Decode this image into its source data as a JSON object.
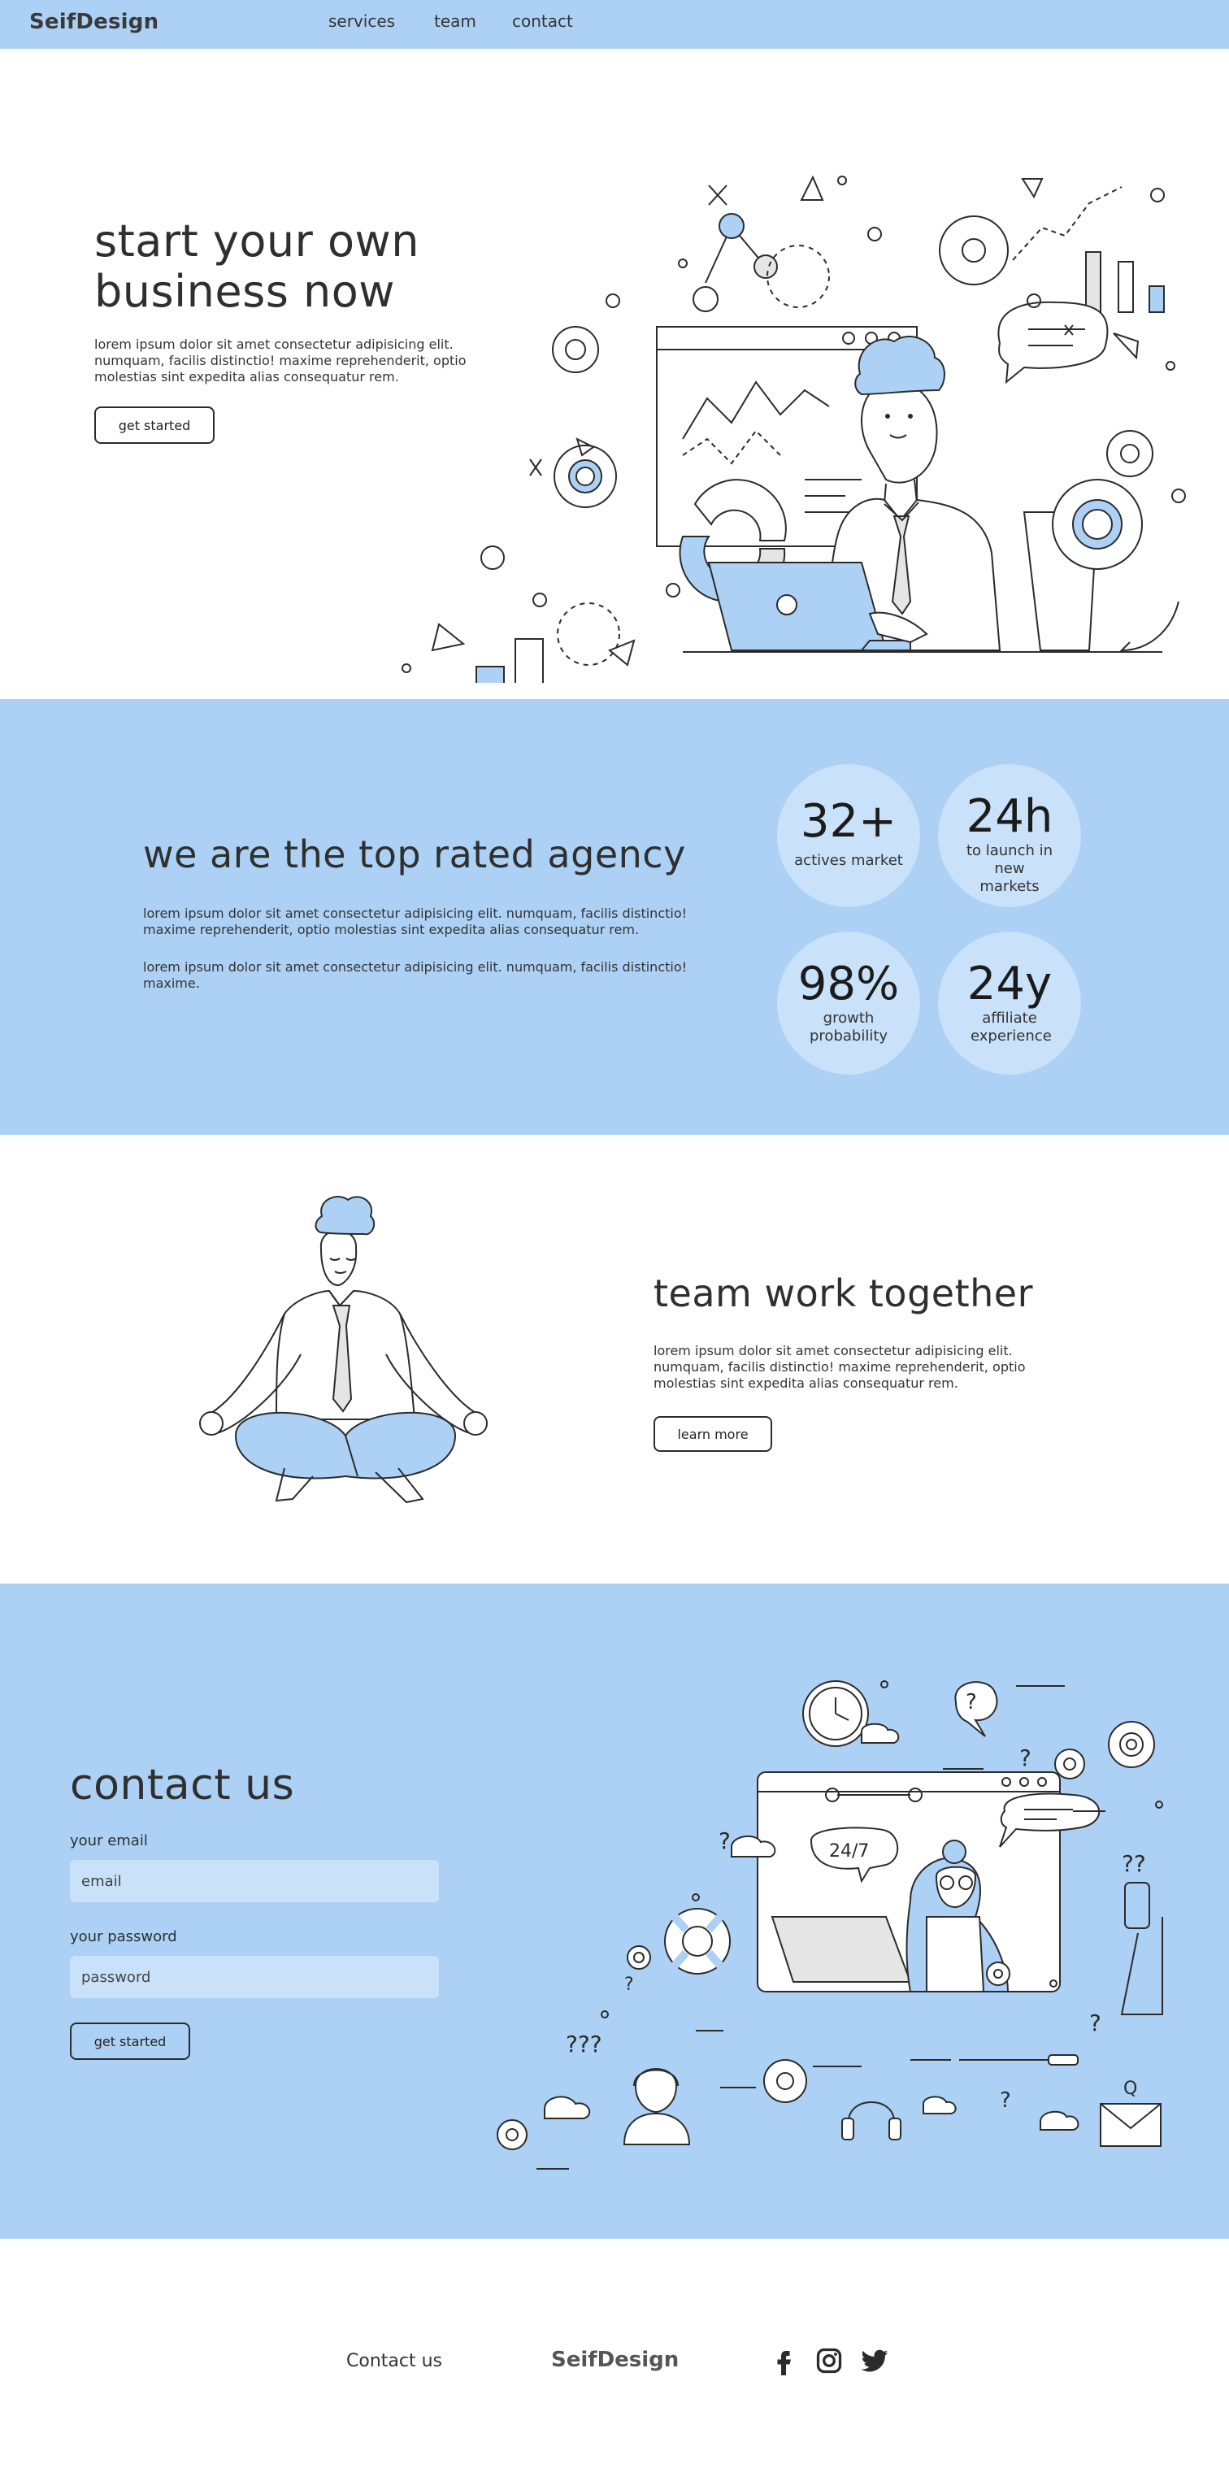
{
  "nav": {
    "logo": "SeifDesign",
    "links": [
      "services",
      "team",
      "contact"
    ]
  },
  "hero": {
    "title": "start your own business now",
    "text": "lorem ipsum dolor sit amet consectetur adipisicing elit. numquam, facilis distinctio! maxime reprehenderit, optio molestias sint expedita alias consequatur rem.",
    "button": "get started"
  },
  "stats": {
    "title": "we are the top rated agency",
    "paragraph1": "lorem ipsum dolor sit amet consectetur adipisicing elit. numquam, facilis distinctio! maxime reprehenderit, optio molestias sint expedita alias consequatur rem.",
    "paragraph2": "lorem ipsum dolor sit amet consectetur adipisicing elit. numquam, facilis distinctio! maxime.",
    "items": [
      {
        "value": "32+",
        "label": "actives market"
      },
      {
        "value": "24h",
        "label": "to launch in new markets"
      },
      {
        "value": "98%",
        "label": "growth probability"
      },
      {
        "value": "24y",
        "label": "affiliate experience"
      }
    ]
  },
  "team": {
    "title": "team work together",
    "text": "lorem ipsum dolor sit amet consectetur adipisicing elit. numquam, facilis distinctio! maxime reprehenderit, optio molestias sint expedita alias consequatur rem.",
    "button": "learn more"
  },
  "contact": {
    "title": "contact us",
    "email_label": "your email",
    "email_placeholder": "email",
    "password_label": "your password",
    "password_placeholder": "password",
    "button": "get started",
    "illustration_badge": "24/7"
  },
  "footer": {
    "contact_link": "Contact us",
    "logo": "SeifDesign",
    "social_icons": [
      "facebook-icon",
      "instagram-icon",
      "twitter-icon"
    ]
  },
  "colors": {
    "accent": "#acd1f4",
    "accent_light": "#c9e1f9",
    "ink": "#2b2b2b"
  }
}
